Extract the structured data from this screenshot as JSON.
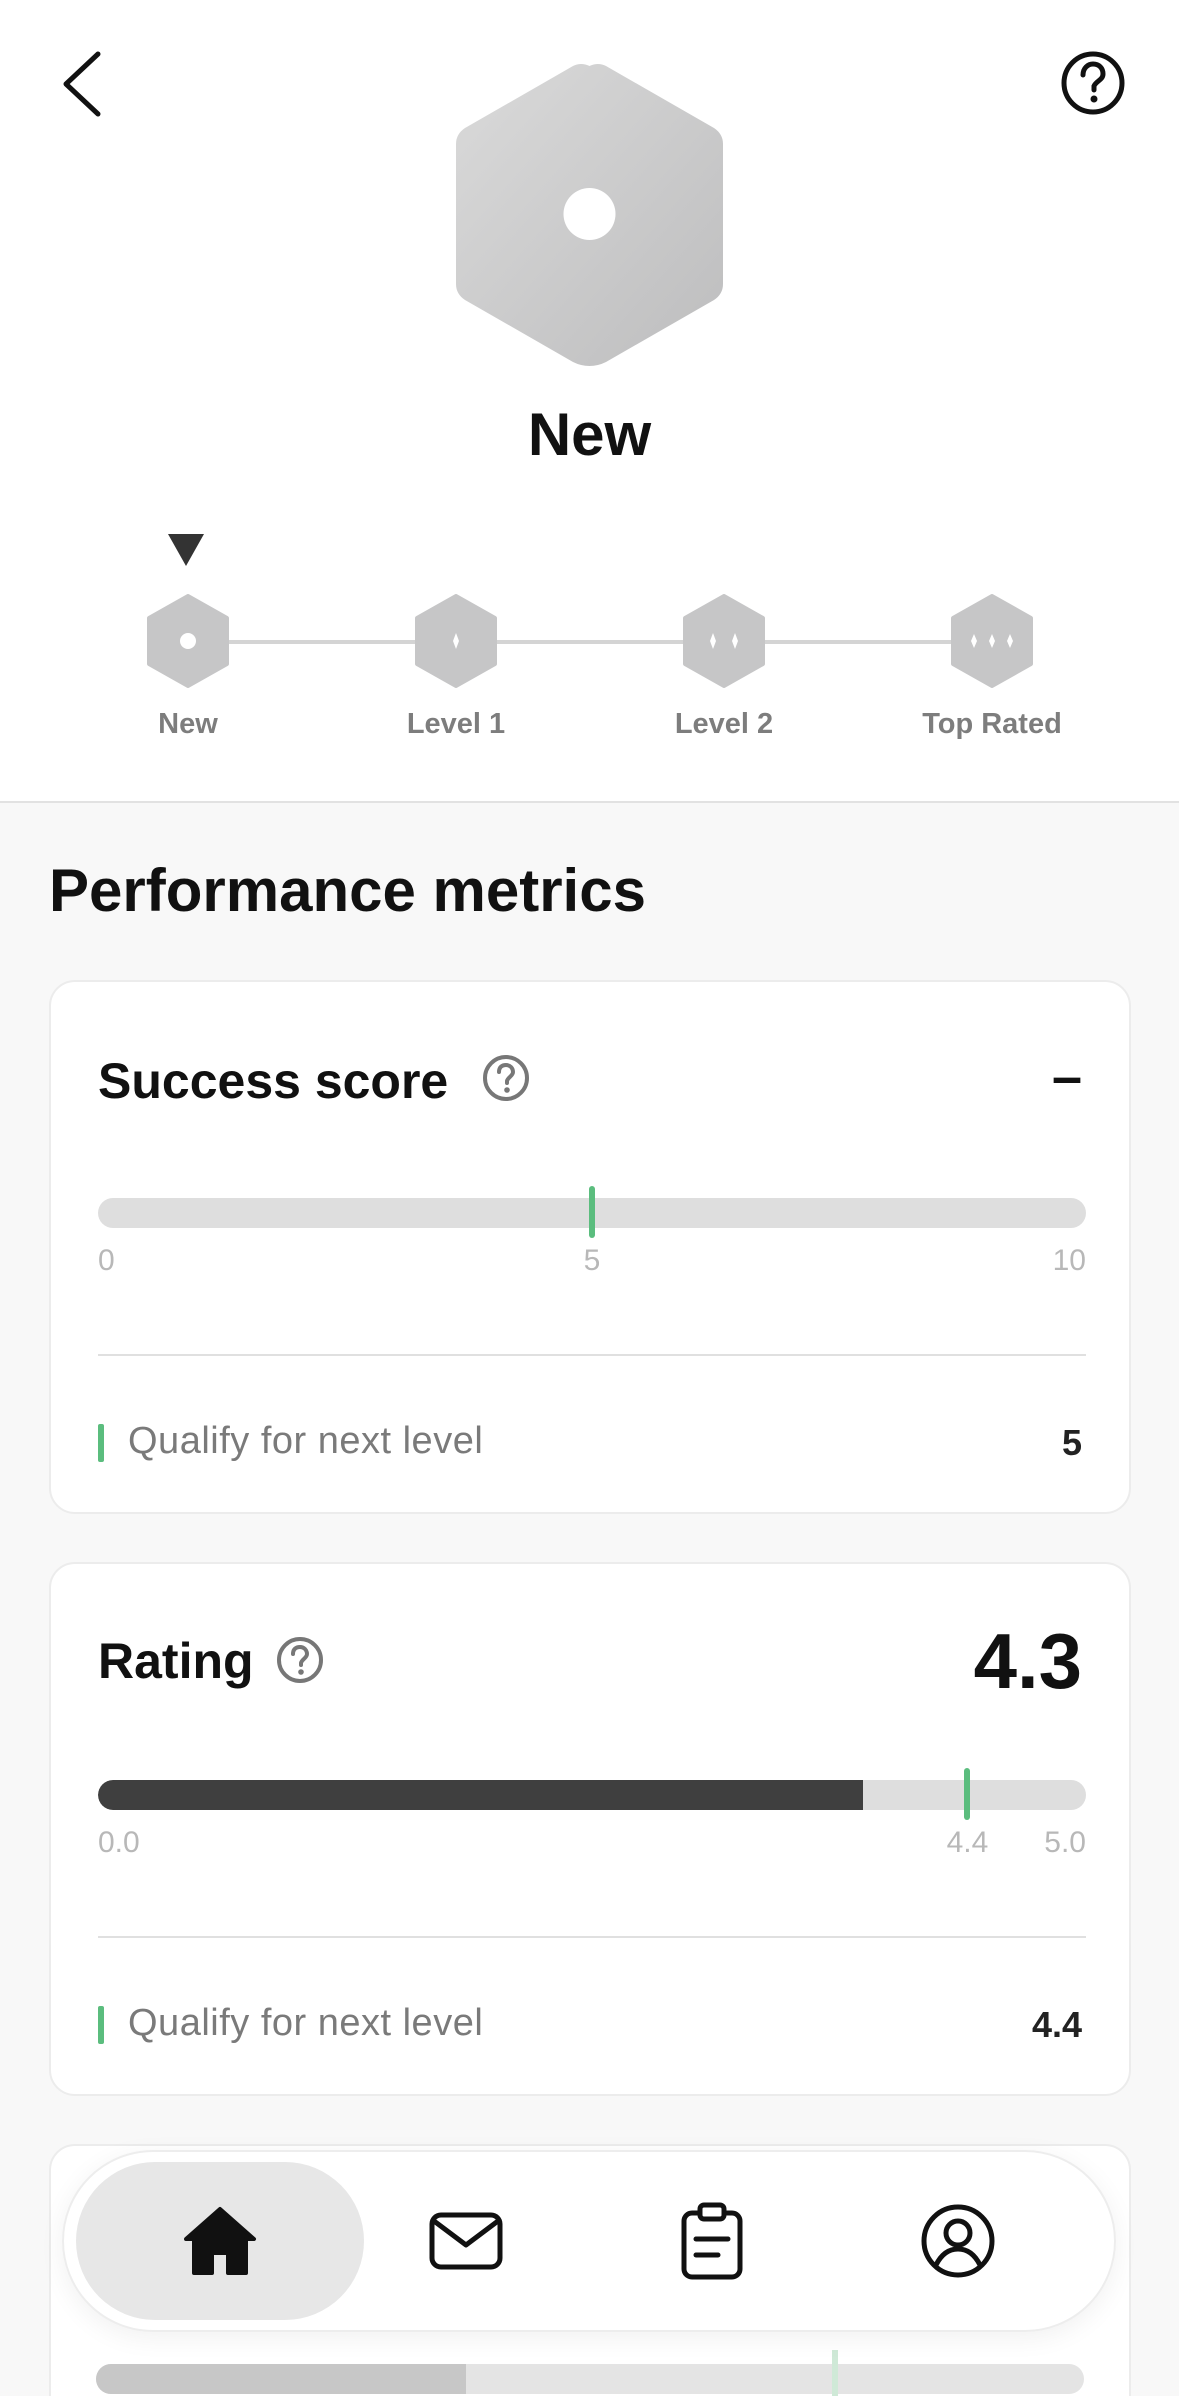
{
  "header": {
    "back_icon": "chevron-left-icon",
    "help_icon": "question-circle-icon",
    "current_level": "New"
  },
  "level_track": {
    "current_index": 0,
    "levels": [
      {
        "label": "New"
      },
      {
        "label": "Level 1"
      },
      {
        "label": "Level 2"
      },
      {
        "label": "Top Rated"
      }
    ]
  },
  "metrics": {
    "section_title": "Performance metrics",
    "success_score": {
      "title": "Success score",
      "value": "–",
      "ticks": [
        "0",
        "5",
        "10"
      ],
      "range": [
        0,
        10
      ],
      "target": 5,
      "qualify_label": "Qualify for next level",
      "qualify_value": "5"
    },
    "rating": {
      "title": "Rating",
      "value": "4.3",
      "ticks": [
        "0.0",
        "4.4",
        "5.0"
      ],
      "range": [
        0,
        5
      ],
      "current": 4.3,
      "target": 4.4,
      "qualify_label": "Qualify for next level",
      "qualify_value": "4.4"
    }
  },
  "nav": {
    "items": [
      {
        "name": "home",
        "icon": "home-icon",
        "active": true
      },
      {
        "name": "messages",
        "icon": "envelope-icon",
        "active": false
      },
      {
        "name": "orders",
        "icon": "clipboard-icon",
        "active": false
      },
      {
        "name": "profile",
        "icon": "user-circle-icon",
        "active": false
      }
    ]
  },
  "colors": {
    "accent_green": "#5bbd7e",
    "badge_gray": "#c6c6c7",
    "bar_dark": "#3f3f3f",
    "bar_track": "#dedede"
  }
}
